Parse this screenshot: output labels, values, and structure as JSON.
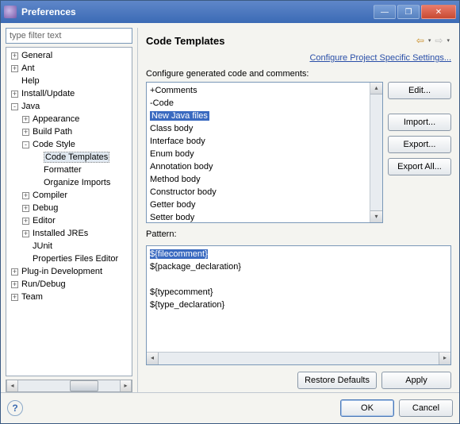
{
  "window": {
    "title": "Preferences"
  },
  "filter_placeholder": "type filter text",
  "navtree": {
    "general": "General",
    "ant": "Ant",
    "help": "Help",
    "install": "Install/Update",
    "java": "Java",
    "appearance": "Appearance",
    "buildpath": "Build Path",
    "codestyle": "Code Style",
    "codetemplates": "Code Templates",
    "formatter": "Formatter",
    "organize": "Organize Imports",
    "compiler": "Compiler",
    "debug": "Debug",
    "editor": "Editor",
    "installedjres": "Installed JREs",
    "junit": "JUnit",
    "propfiles": "Properties Files Editor",
    "plugindev": "Plug-in Development",
    "rundebug": "Run/Debug",
    "team": "Team"
  },
  "page": {
    "title": "Code Templates",
    "project_link": "Configure Project Specific Settings...",
    "configure_label": "Configure generated code and comments:",
    "pattern_label": "Pattern:"
  },
  "template_tree": {
    "comments": "Comments",
    "code": "Code",
    "newjava": "New Java files",
    "classbody": "Class body",
    "interfacebody": "Interface body",
    "enumbody": "Enum body",
    "annotationbody": "Annotation body",
    "methodbody": "Method body",
    "constructorbody": "Constructor body",
    "getterbody": "Getter body",
    "setterbody": "Setter body"
  },
  "pattern": {
    "l1": "${filecomment}",
    "l2": "${package_declaration}",
    "l3": "",
    "l4": "${typecomment}",
    "l5": "${type_declaration}"
  },
  "buttons": {
    "edit": "Edit...",
    "import": "Import...",
    "export": "Export...",
    "exportall": "Export All...",
    "restore": "Restore Defaults",
    "apply": "Apply",
    "ok": "OK",
    "cancel": "Cancel"
  }
}
